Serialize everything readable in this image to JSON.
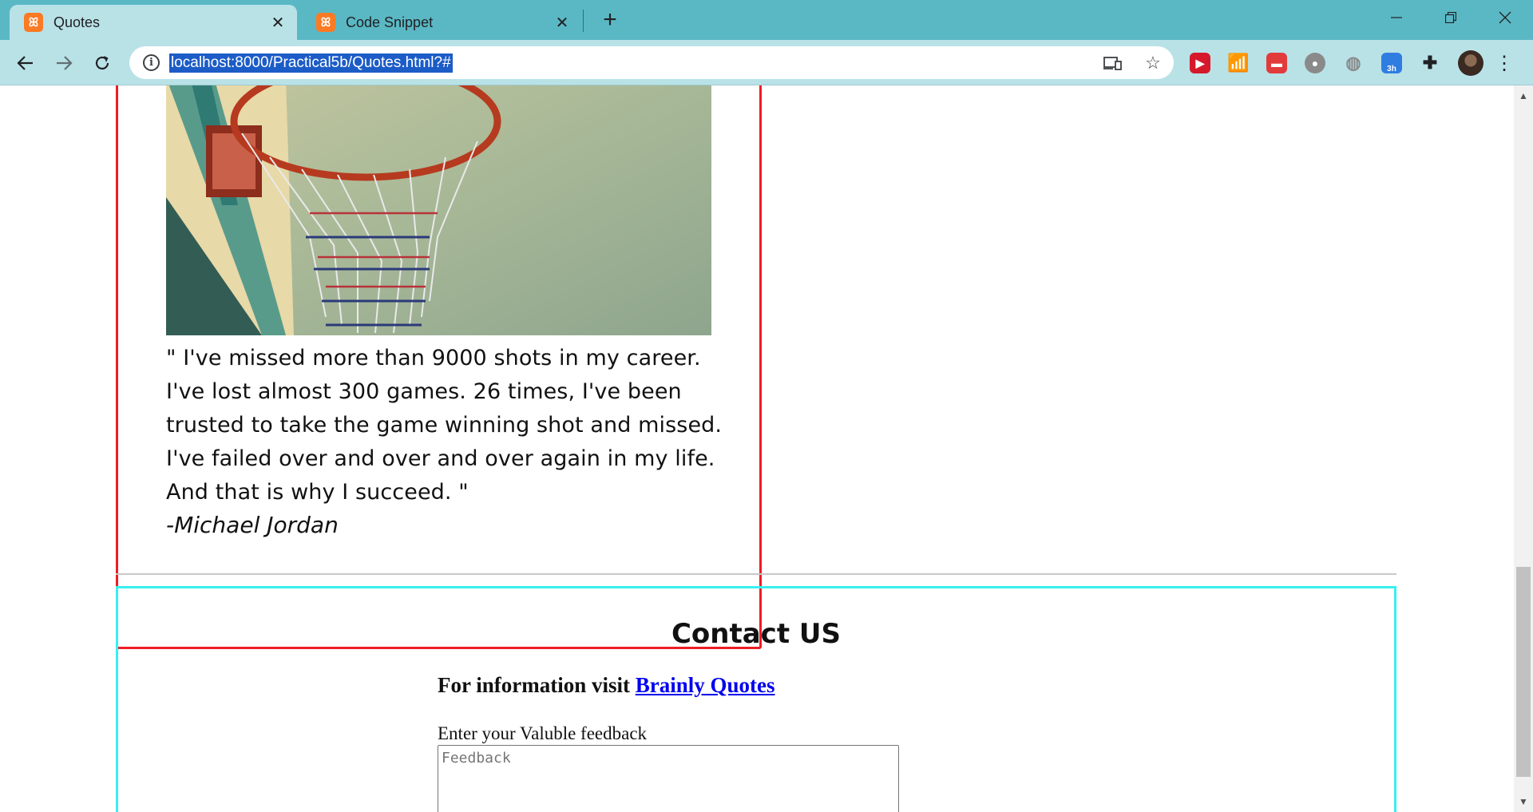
{
  "browser": {
    "tabs": [
      {
        "title": "Quotes",
        "active": true
      },
      {
        "title": "Code Snippet",
        "active": false
      }
    ],
    "url": "localhost:8000/Practical5b/Quotes.html?#",
    "accent_color": "#5ab8c4",
    "toolbar_color": "#b9e2e7",
    "extension_badge": "3h"
  },
  "page": {
    "quote": {
      "text": "\" I've missed more than 9000 shots in my career. I've lost almost 300 games. 26 times, I've been trusted to take the game winning shot and missed. I've failed over and over and over again in my life. And that is why I succeed. \"",
      "author": "-Michael Jordan",
      "border_color": "#ee1c25"
    },
    "contact": {
      "title": "Contact US",
      "info_prefix": "For information visit ",
      "info_link": "Brainly Quotes",
      "feedback_label": "Enter your Valuble feedback",
      "feedback_placeholder": "Feedback",
      "border_color": "#38f0f0"
    }
  }
}
